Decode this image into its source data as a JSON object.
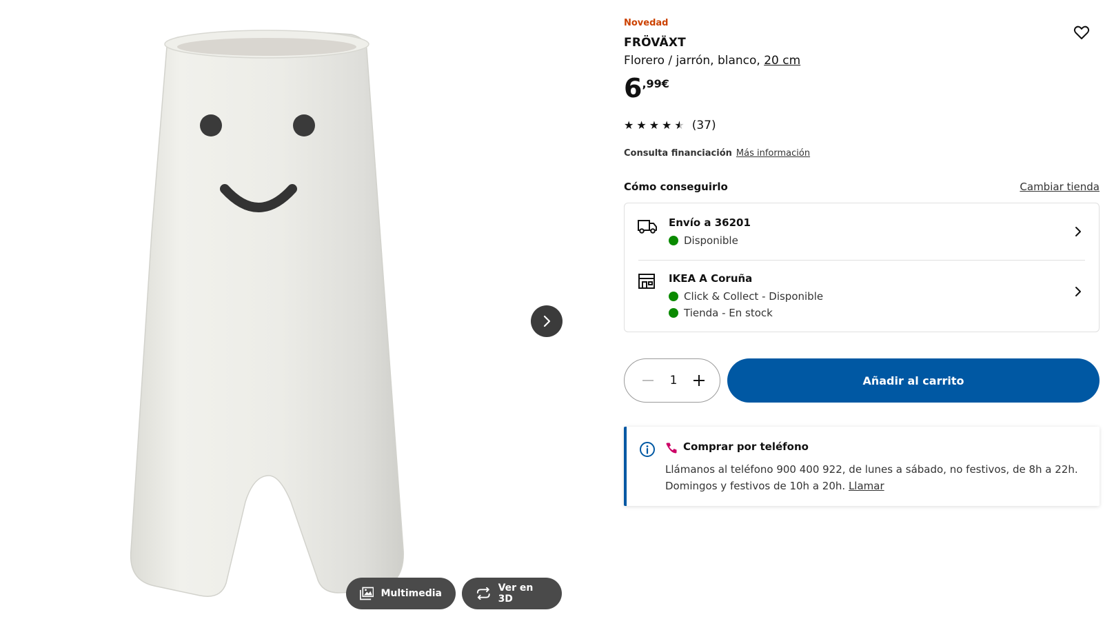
{
  "gallery": {
    "media_label": "Multimedia",
    "view3d_label": "Ver en 3D",
    "icons": {
      "next": "chevron-right-icon",
      "media": "image-gallery-icon",
      "view3d": "rotate-3d-icon"
    }
  },
  "product": {
    "badge": "Novedad",
    "name": "FRÖVÄXT",
    "description": "Florero / jarrón, blanco,",
    "size": "20 cm",
    "price_int": "6",
    "price_dec": ",99€",
    "rating": {
      "stars": 4.5,
      "count": "(37)"
    },
    "financing": {
      "label": "Consulta financiación",
      "link": "Más información"
    }
  },
  "availability": {
    "title": "Cómo conseguirlo",
    "change_store": "Cambiar tienda",
    "delivery": {
      "title": "Envío a 36201",
      "status": "Disponible"
    },
    "store": {
      "title": "IKEA A Coruña",
      "click_collect": "Click & Collect - Disponible",
      "in_store": "Tienda - En stock"
    }
  },
  "cart": {
    "quantity": "1",
    "add_label": "Añadir al carrito"
  },
  "phone": {
    "title": "Comprar por teléfono",
    "text": "Llámanos al teléfono 900 400 922, de lunes a sábado, no festivos, de 8h a 22h. Domingos y festivos de 10h a 20h.",
    "call_link": "Llamar"
  },
  "colors": {
    "badge": "#cc4200",
    "primary": "#0058a3",
    "available": "#0a8a00",
    "phone_icon": "#cc0066"
  }
}
